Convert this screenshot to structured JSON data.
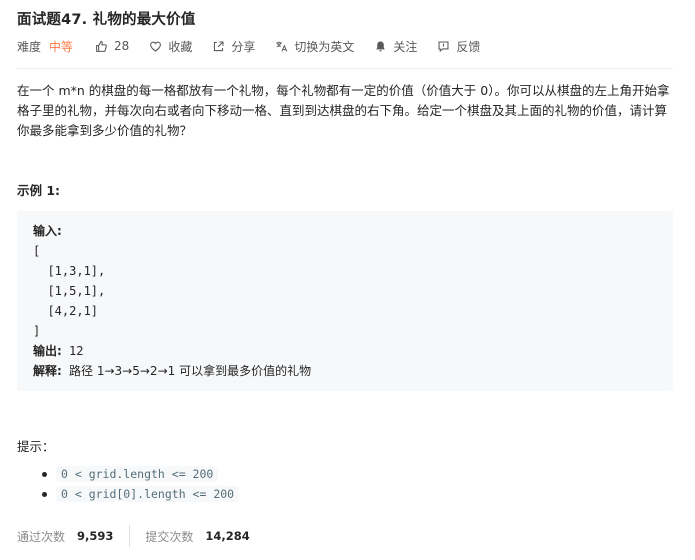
{
  "problem": {
    "title": "面试题47. 礼物的最大价值",
    "difficulty_label": "难度",
    "difficulty": "中等",
    "likes": "28",
    "favorite_label": "收藏",
    "share_label": "分享",
    "switch_lang_label": "切换为英文",
    "follow_label": "关注",
    "feedback_label": "反馈",
    "colors": {
      "difficulty": "#ff7a45",
      "text": "#262626",
      "muted": "#595959"
    }
  },
  "description": "在一个 m*n 的棋盘的每一格都放有一个礼物，每个礼物都有一定的价值（价值大于 0）。你可以从棋盘的左上角开始拿格子里的礼物，并每次向右或者向下移动一格、直到到达棋盘的右下角。给定一个棋盘及其上面的礼物的价值，请计算你最多能拿到多少价值的礼物？",
  "example": {
    "heading": "示例 1:",
    "input_label": "输入:",
    "input_lines": [
      "[",
      "  [1,3,1],",
      "  [1,5,1],",
      "  [4,2,1]",
      "]"
    ],
    "output_label": "输出:",
    "output_value": "12",
    "explain_label": "解释:",
    "explain_value": "路径 1→3→5→2→1 可以拿到最多价值的礼物"
  },
  "hints": {
    "heading": "提示：",
    "items": [
      "0 < grid.length <= 200",
      "0 < grid[0].length <= 200"
    ]
  },
  "stats": {
    "accepted_label": "通过次数",
    "accepted_value": "9,593",
    "submitted_label": "提交次数",
    "submitted_value": "14,284"
  }
}
